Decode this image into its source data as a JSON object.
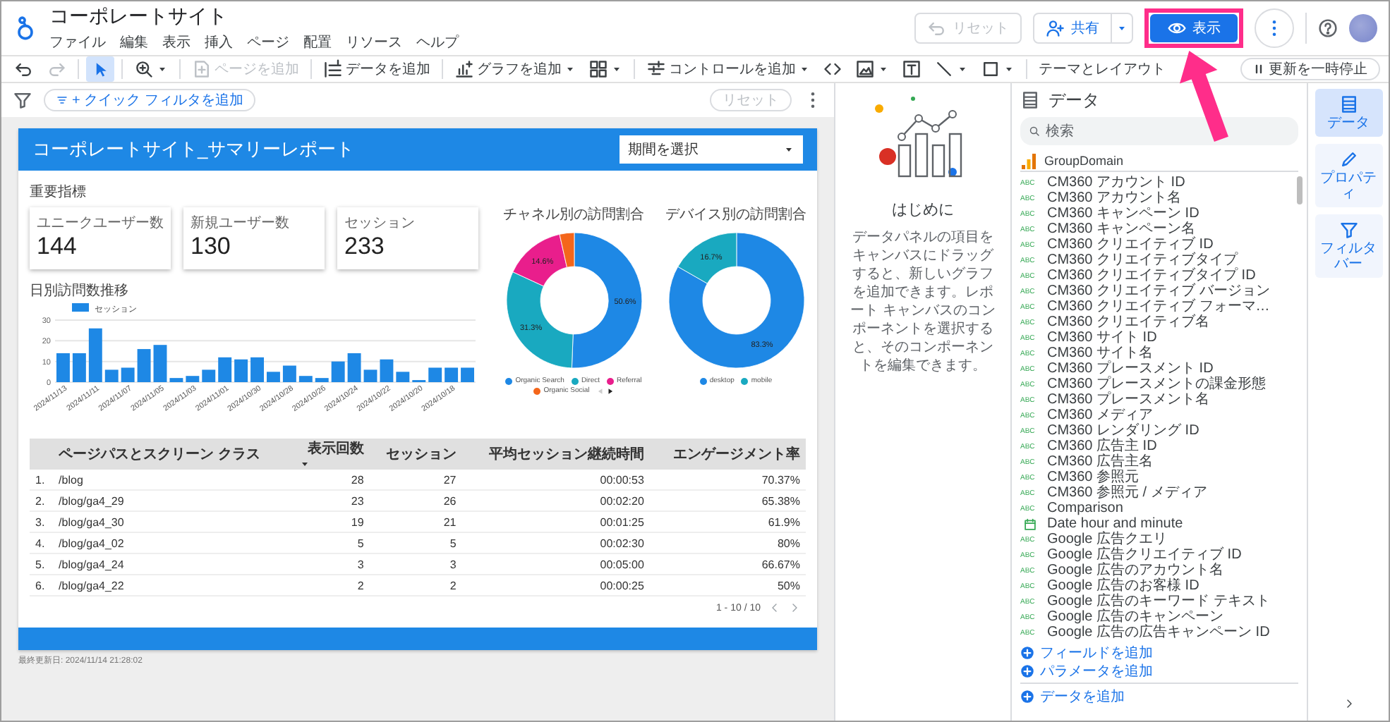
{
  "app": {
    "title": "コーポレートサイト",
    "menu": [
      "ファイル",
      "編集",
      "表示",
      "挿入",
      "ページ",
      "配置",
      "リソース",
      "ヘルプ"
    ]
  },
  "header_actions": {
    "reset": {
      "label": "リセット",
      "disabled": true
    },
    "share": {
      "label": "共有"
    },
    "view": {
      "label": "表示"
    }
  },
  "toolbar": [
    {
      "kind": "undo",
      "disabled": false,
      "selected": false
    },
    {
      "kind": "redo",
      "disabled": true,
      "selected": false
    },
    {
      "kind": "divider"
    },
    {
      "kind": "select",
      "disabled": false,
      "selected": true
    },
    {
      "kind": "divider"
    },
    {
      "kind": "zoom",
      "dropdown": true,
      "disabled": false,
      "selected": false
    },
    {
      "kind": "divider"
    },
    {
      "kind": "add-page",
      "label": "ページを追加",
      "disabled": true,
      "selected": false
    },
    {
      "kind": "divider"
    },
    {
      "kind": "add-data",
      "label": "データを追加",
      "disabled": false,
      "selected": false
    },
    {
      "kind": "divider"
    },
    {
      "kind": "add-chart",
      "label": "グラフを追加",
      "dropdown": true,
      "disabled": false,
      "selected": false
    },
    {
      "kind": "components",
      "dropdown": true,
      "disabled": false,
      "selected": false
    },
    {
      "kind": "divider"
    },
    {
      "kind": "controls",
      "label": "コントロールを追加",
      "dropdown": true,
      "disabled": false,
      "selected": false
    },
    {
      "kind": "code",
      "disabled": false,
      "selected": false
    },
    {
      "kind": "image",
      "dropdown": true,
      "disabled": false,
      "selected": false
    },
    {
      "kind": "textbox",
      "disabled": false,
      "selected": false
    },
    {
      "kind": "line",
      "dropdown": true,
      "disabled": false,
      "selected": false
    },
    {
      "kind": "shape",
      "dropdown": true,
      "disabled": false,
      "selected": false
    },
    {
      "kind": "divider"
    },
    {
      "kind": "theme",
      "label": "テーマとレイアウト",
      "disabled": false,
      "selected": false
    }
  ],
  "pause_updates": {
    "label": "更新を一時停止"
  },
  "filter_bar": {
    "quick_filter": "+ クイック フィルタを追加",
    "reset": {
      "label": "リセット",
      "disabled": true
    }
  },
  "report": {
    "title": "コーポレートサイト_サマリーレポート",
    "date_picker": "期間を選択",
    "kpi_heading": "重要指標",
    "kpis": [
      {
        "label": "ユニークユーザー数",
        "value": "144"
      },
      {
        "label": "新規ユーザー数",
        "value": "130"
      },
      {
        "label": "セッション",
        "value": "233"
      }
    ],
    "trend_chart": {
      "chart_data": {
        "type": "bar",
        "title": "日別訪問数推移",
        "ylim": [
          0,
          30
        ],
        "yticks": [
          0,
          10,
          20,
          30
        ],
        "categories": [
          "2024/11/13",
          null,
          "2024/11/11",
          null,
          "2024/11/07",
          null,
          "2024/11/05",
          null,
          "2024/11/03",
          null,
          "2024/11/01",
          null,
          "2024/10/30",
          null,
          "2024/10/28",
          null,
          "2024/10/26",
          null,
          "2024/10/24",
          null,
          "2024/10/22",
          null,
          "2024/10/20",
          null,
          "2024/10/18",
          null
        ],
        "series": [
          {
            "name": "セッション",
            "color": "#1e88e5",
            "values": [
              14,
              14,
              26,
              6,
              7,
              16,
              18,
              2,
              3,
              6,
              12,
              11,
              12,
              5,
              8,
              3,
              2,
              10,
              14,
              6,
              11,
              5,
              1,
              7,
              7,
              7
            ]
          }
        ]
      }
    },
    "channel_chart": {
      "chart_data": {
        "type": "donut",
        "title": "チャネル別の訪問割合",
        "categories": [
          "Organic Search",
          "Direct",
          "Referral",
          "Organic Social"
        ],
        "values": [
          50.6,
          31.3,
          14.6,
          3.5
        ],
        "colors": [
          "#1e88e5",
          "#19a9c0",
          "#e91e8c",
          "#f4661b"
        ],
        "value_labels": [
          "50.6%",
          "31.3%",
          "14.6%",
          null
        ]
      }
    },
    "device_chart": {
      "chart_data": {
        "type": "donut",
        "title": "デバイス別の訪問割合",
        "categories": [
          "desktop",
          "mobile"
        ],
        "values": [
          83.3,
          16.7
        ],
        "colors": [
          "#1e88e5",
          "#19a9c0"
        ],
        "value_labels": [
          "83.3%",
          "16.7%"
        ]
      }
    },
    "table": {
      "columns": [
        {
          "label": "ページパスとスクリーン クラス",
          "sorted": false
        },
        {
          "label": "表示回数",
          "sorted": true
        },
        {
          "label": "セッション",
          "sorted": false
        },
        {
          "label": "平均セッション継続時間",
          "sorted": false
        },
        {
          "label": "エンゲージメント率",
          "sorted": false
        }
      ],
      "rows": [
        {
          "index": "1.",
          "cells": [
            "/blog",
            "28",
            "27",
            "00:00:53",
            "70.37%"
          ]
        },
        {
          "index": "2.",
          "cells": [
            "/blog/ga4_29",
            "23",
            "26",
            "00:02:20",
            "65.38%"
          ]
        },
        {
          "index": "3.",
          "cells": [
            "/blog/ga4_30",
            "19",
            "21",
            "00:01:25",
            "61.9%"
          ]
        },
        {
          "index": "4.",
          "cells": [
            "/blog/ga4_02",
            "5",
            "5",
            "00:02:30",
            "80%"
          ]
        },
        {
          "index": "5.",
          "cells": [
            "/blog/ga4_24",
            "3",
            "3",
            "00:05:00",
            "66.67%"
          ]
        },
        {
          "index": "6.",
          "cells": [
            "/blog/ga4_22",
            "2",
            "2",
            "00:00:25",
            "50%"
          ]
        }
      ],
      "pagination": "1 - 10 / 10"
    },
    "last_updated": "最終更新日: 2024/11/14 21:28:02"
  },
  "intro": {
    "title": "はじめに",
    "text": "データパネルの項目をキャンバスにドラッグすると、新しいグラフを追加できます。レポート キャンバスのコンポーネントを選択すると、そのコンポーネントを編集できます。"
  },
  "data_panel": {
    "title": "データ",
    "search_placeholder": "検索",
    "source": "GroupDomain",
    "fields": [
      {
        "kind": "text",
        "badge": "ABC",
        "name": "CM360 アカウント ID"
      },
      {
        "kind": "text",
        "badge": "ABC",
        "name": "CM360 アカウント名"
      },
      {
        "kind": "text",
        "badge": "ABC",
        "name": "CM360 キャンペーン ID"
      },
      {
        "kind": "text",
        "badge": "ABC",
        "name": "CM360 キャンペーン名"
      },
      {
        "kind": "text",
        "badge": "ABC",
        "name": "CM360 クリエイティブ ID"
      },
      {
        "kind": "text",
        "badge": "ABC",
        "name": "CM360 クリエイティブタイプ"
      },
      {
        "kind": "text",
        "badge": "ABC",
        "name": "CM360 クリエイティブタイプ ID"
      },
      {
        "kind": "text",
        "badge": "ABC",
        "name": "CM360 クリエイティブ バージョン"
      },
      {
        "kind": "text",
        "badge": "ABC",
        "name": "CM360 クリエイティブ フォーマ…"
      },
      {
        "kind": "text",
        "badge": "ABC",
        "name": "CM360 クリエイティブ名"
      },
      {
        "kind": "text",
        "badge": "ABC",
        "name": "CM360 サイト ID"
      },
      {
        "kind": "text",
        "badge": "ABC",
        "name": "CM360 サイト名"
      },
      {
        "kind": "text",
        "badge": "ABC",
        "name": "CM360 プレースメント ID"
      },
      {
        "kind": "text",
        "badge": "ABC",
        "name": "CM360 プレースメントの課金形態"
      },
      {
        "kind": "text",
        "badge": "ABC",
        "name": "CM360 プレースメント名"
      },
      {
        "kind": "text",
        "badge": "ABC",
        "name": "CM360 メディア"
      },
      {
        "kind": "text",
        "badge": "ABC",
        "name": "CM360 レンダリング ID"
      },
      {
        "kind": "text",
        "badge": "ABC",
        "name": "CM360 広告主 ID"
      },
      {
        "kind": "text",
        "badge": "ABC",
        "name": "CM360 広告主名"
      },
      {
        "kind": "text",
        "badge": "ABC",
        "name": "CM360 参照元"
      },
      {
        "kind": "text",
        "badge": "ABC",
        "name": "CM360 参照元 / メディア"
      },
      {
        "kind": "text",
        "badge": "ABC",
        "name": "Comparison"
      },
      {
        "kind": "date",
        "name": "Date hour and minute"
      },
      {
        "kind": "text",
        "badge": "ABC",
        "name": "Google 広告クエリ"
      },
      {
        "kind": "text",
        "badge": "ABC",
        "name": "Google 広告クリエイティブ ID"
      },
      {
        "kind": "text",
        "badge": "ABC",
        "name": "Google 広告のアカウント名"
      },
      {
        "kind": "text",
        "badge": "ABC",
        "name": "Google 広告のお客様 ID"
      },
      {
        "kind": "text",
        "badge": "ABC",
        "name": "Google 広告のキーワード テキスト"
      },
      {
        "kind": "text",
        "badge": "ABC",
        "name": "Google 広告のキャンペーン"
      },
      {
        "kind": "text",
        "badge": "ABC",
        "name": "Google 広告の広告キャンペーン ID"
      }
    ],
    "add_field": "フィールドを追加",
    "add_parameter": "パラメータを追加",
    "add_data": "データを追加"
  },
  "rail": [
    {
      "kind": "data",
      "label": "データ",
      "selected": true
    },
    {
      "kind": "properties",
      "label": "プロパティ",
      "selected": false
    },
    {
      "kind": "filter",
      "label": "フィルタバー",
      "selected": false
    }
  ]
}
